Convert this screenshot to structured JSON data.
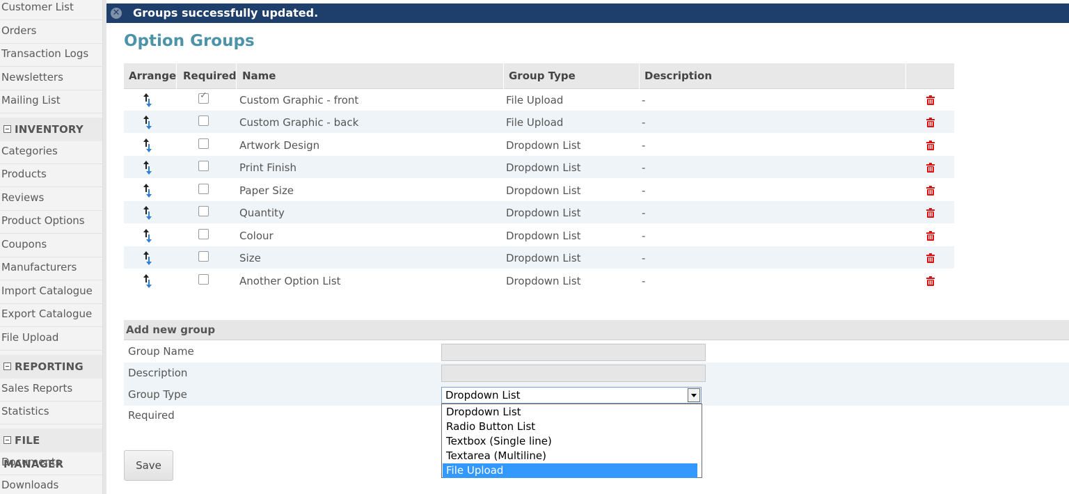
{
  "sidebar": {
    "items_top": [
      "Customer List",
      "Orders",
      "Transaction Logs",
      "Newsletters",
      "Mailing List"
    ],
    "section_inventory": "INVENTORY",
    "items_inventory": [
      "Categories",
      "Products",
      "Reviews",
      "Product Options",
      "Coupons",
      "Manufacturers",
      "Import Catalogue",
      "Export Catalogue",
      "File Upload"
    ],
    "section_reporting": "REPORTING",
    "items_reporting": [
      "Sales Reports",
      "Statistics"
    ],
    "section_files": "FILE MANAGER",
    "items_files": [
      "Documents",
      "Downloads"
    ]
  },
  "notice": {
    "message": "Groups successfully updated."
  },
  "page": {
    "title": "Option Groups"
  },
  "table": {
    "headers": [
      "Arrange",
      "Required",
      "Name",
      "Group Type",
      "Description"
    ],
    "rows": [
      {
        "name": "Custom Graphic - front",
        "type": "File Upload",
        "description": "-",
        "required": true
      },
      {
        "name": "Custom Graphic - back",
        "type": "File Upload",
        "description": "-",
        "required": false
      },
      {
        "name": "Artwork Design",
        "type": "Dropdown List",
        "description": "-",
        "required": false
      },
      {
        "name": "Print Finish",
        "type": "Dropdown List",
        "description": "-",
        "required": false
      },
      {
        "name": "Paper Size",
        "type": "Dropdown List",
        "description": "-",
        "required": false
      },
      {
        "name": "Quantity",
        "type": "Dropdown List",
        "description": "-",
        "required": false
      },
      {
        "name": "Colour",
        "type": "Dropdown List",
        "description": "-",
        "required": false
      },
      {
        "name": "Size",
        "type": "Dropdown List",
        "description": "-",
        "required": false
      },
      {
        "name": "Another Option List",
        "type": "Dropdown List",
        "description": "-",
        "required": false
      }
    ]
  },
  "add_group": {
    "title": "Add new group",
    "labels": {
      "name": "Group Name",
      "description": "Description",
      "type": "Group Type",
      "required": "Required"
    },
    "group_name_value": "",
    "description_value": "",
    "group_type_value": "Dropdown List",
    "group_type_options": [
      "Dropdown List",
      "Radio Button List",
      "Textbox (Single line)",
      "Textarea (Multiline)",
      "File Upload"
    ],
    "highlighted_option": "File Upload",
    "save_label": "Save"
  },
  "colors": {
    "notice_bg": "#1e3f6b",
    "title": "#4d93a8",
    "trash": "#dd1111",
    "highlight": "#3399ff"
  }
}
